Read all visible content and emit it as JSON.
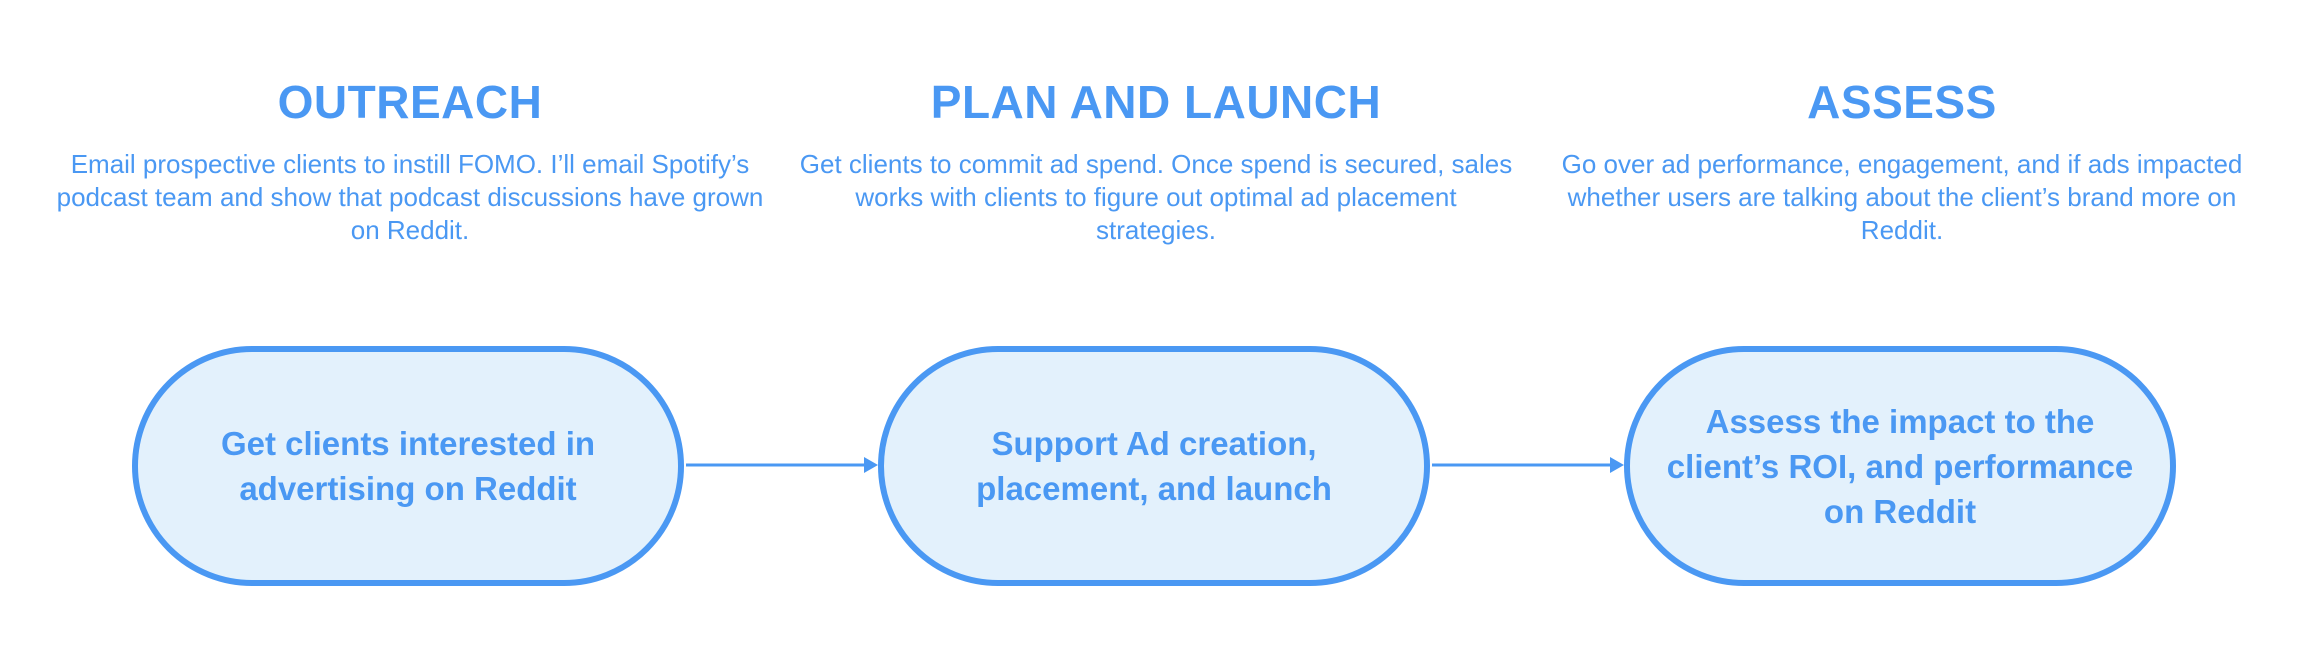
{
  "stages": [
    {
      "heading": "OUTREACH",
      "description": "Email prospective clients to instill FOMO. I’ll email Spotify’s podcast team and show that podcast discussions have grown on Reddit.",
      "step": "Get clients interested in advertising on Reddit"
    },
    {
      "heading": "PLAN AND LAUNCH",
      "description": "Get clients to commit ad spend. Once spend is secured, sales works with clients to figure out optimal ad placement strategies.",
      "step": "Support Ad creation, placement, and launch"
    },
    {
      "heading": "ASSESS",
      "description": "Go over ad performance, engagement, and if ads impacted whether users are talking about the client’s brand more on Reddit.",
      "step": "Assess the impact to the client’s ROI, and performance on Reddit"
    }
  ],
  "colors": {
    "accent": "#4a98f3",
    "pill_fill": "#e3f1fc",
    "background": "#ffffff"
  },
  "icons": [
    "arrow-right-icon",
    "arrow-right-icon"
  ]
}
